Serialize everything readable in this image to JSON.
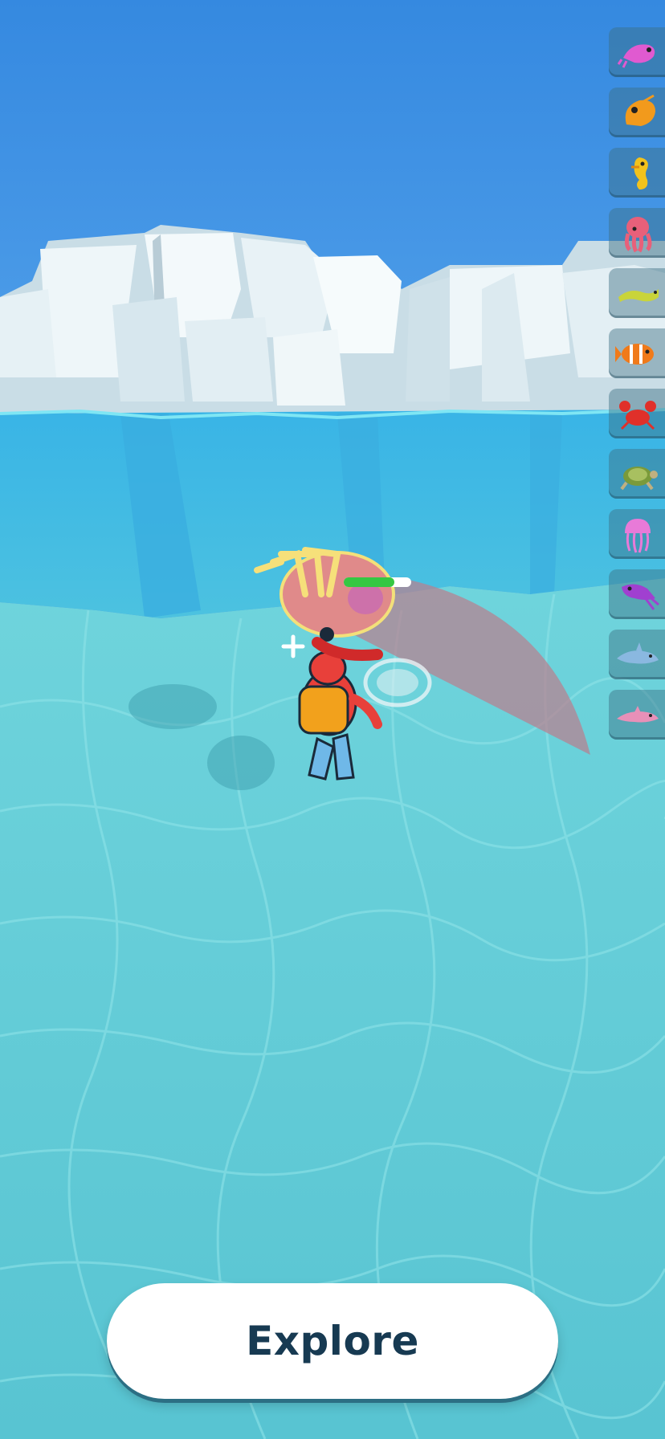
{
  "explore_button": {
    "label": "Explore"
  },
  "hud": {
    "health_fraction": 0.75,
    "health_color": "#35c742"
  },
  "collection_sidebar": {
    "items": [
      {
        "name": "pink-shrimp-icon",
        "color": "#e05ad0"
      },
      {
        "name": "orange-shrimp-icon",
        "color": "#f29a1c"
      },
      {
        "name": "yellow-seahorse-icon",
        "color": "#f2c21c"
      },
      {
        "name": "pink-octopus-icon",
        "color": "#e8607a"
      },
      {
        "name": "yellow-eel-icon",
        "color": "#c9d43a"
      },
      {
        "name": "clownfish-icon",
        "color": "#f07a1a"
      },
      {
        "name": "red-crab-icon",
        "color": "#e0302a"
      },
      {
        "name": "sea-turtle-icon",
        "color": "#7a9a3a"
      },
      {
        "name": "pink-jellyfish-icon",
        "color": "#e87ad8"
      },
      {
        "name": "purple-squid-icon",
        "color": "#a040d0"
      },
      {
        "name": "blue-dolphin-icon",
        "color": "#8ab8e0"
      },
      {
        "name": "pink-dolphin-icon",
        "color": "#e890b8"
      }
    ]
  },
  "colors": {
    "sky": "#3a8ce0",
    "water": "#5ecbd6",
    "ice": "#eef6f8",
    "attack_cone": "#b07a8a"
  }
}
